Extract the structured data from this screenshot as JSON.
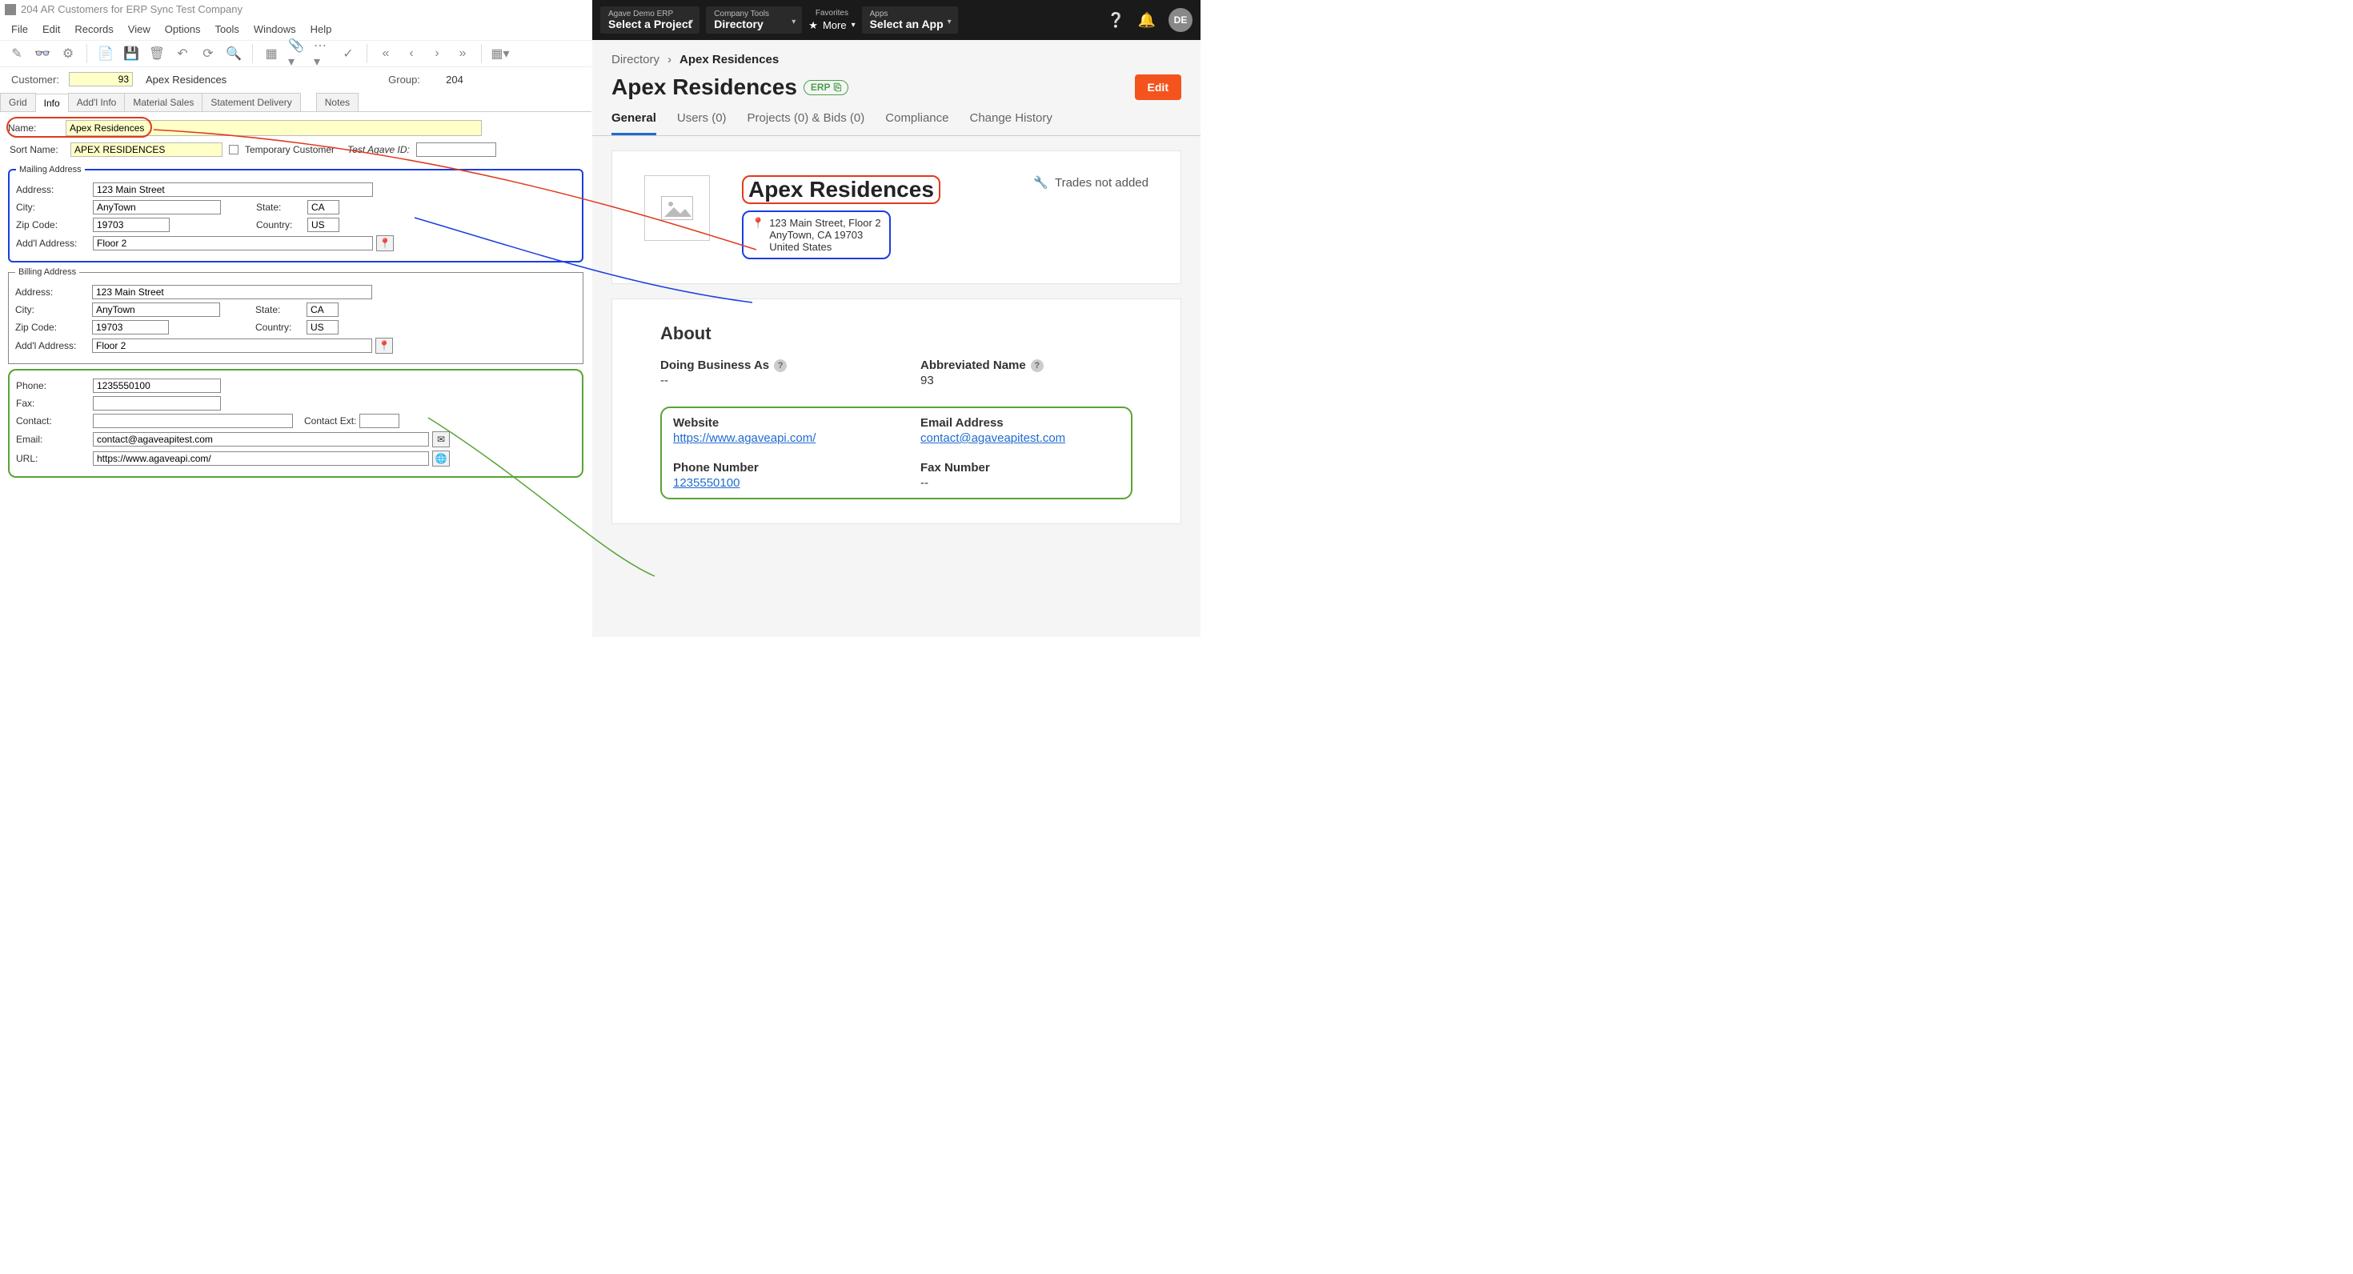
{
  "erp": {
    "window_title": "204 AR Customers for ERP Sync Test Company",
    "menus": [
      "File",
      "Edit",
      "Records",
      "View",
      "Options",
      "Tools",
      "Windows",
      "Help"
    ],
    "customer_label": "Customer:",
    "customer_number": "93",
    "customer_name": "Apex Residences",
    "group_label": "Group:",
    "group_value": "204",
    "tabs": [
      "Grid",
      "Info",
      "Add'l Info",
      "Material Sales",
      "Statement Delivery",
      "Notes"
    ],
    "active_tab": "Info",
    "name_label": "Name:",
    "name_value": "Apex Residences",
    "sort_label": "Sort Name:",
    "sort_value": "APEX RESIDENCES",
    "temp_customer_label": "Temporary Customer",
    "test_agave_label": "Test Agave ID:",
    "mailing": {
      "legend": "Mailing Address",
      "address_label": "Address:",
      "address": "123 Main Street",
      "city_label": "City:",
      "city": "AnyTown",
      "state_label": "State:",
      "state": "CA",
      "zip_label": "Zip Code:",
      "zip": "19703",
      "country_label": "Country:",
      "country": "US",
      "addl_label": "Add'l Address:",
      "addl": "Floor 2"
    },
    "billing": {
      "legend": "Billing Address",
      "address_label": "Address:",
      "address": "123 Main Street",
      "city_label": "City:",
      "city": "AnyTown",
      "state_label": "State:",
      "state": "CA",
      "zip_label": "Zip Code:",
      "zip": "19703",
      "country_label": "Country:",
      "country": "US",
      "addl_label": "Add'l Address:",
      "addl": "Floor 2"
    },
    "contact": {
      "phone_label": "Phone:",
      "phone": "1235550100",
      "fax_label": "Fax:",
      "fax": "",
      "contact_label": "Contact:",
      "contact": "",
      "contact_ext_label": "Contact Ext:",
      "contact_ext": "",
      "email_label": "Email:",
      "email": "contact@agaveapitest.com",
      "url_label": "URL:",
      "url": "https://www.agaveapi.com/"
    }
  },
  "web": {
    "topbar": {
      "erp_small": "Agave Demo ERP",
      "erp_big": "Select a Project",
      "tools_small": "Company Tools",
      "tools_big": "Directory",
      "fav_small": "Favorites",
      "fav_more": "More",
      "apps_small": "Apps",
      "apps_big": "Select an App",
      "avatar": "DE"
    },
    "breadcrumb": {
      "root": "Directory",
      "current": "Apex Residences"
    },
    "title": "Apex Residences",
    "badge": "ERP",
    "edit": "Edit",
    "tabs": [
      "General",
      "Users (0)",
      "Projects (0) & Bids (0)",
      "Compliance",
      "Change History"
    ],
    "card": {
      "name": "Apex Residences",
      "addr1": "123 Main Street, Floor 2",
      "addr2": "AnyTown, CA 19703",
      "addr3": "United States",
      "trades": "Trades not added"
    },
    "about": {
      "heading": "About",
      "dba_label": "Doing Business As",
      "dba_value": "--",
      "abbr_label": "Abbreviated Name",
      "abbr_value": "93",
      "website_label": "Website",
      "website_value": "https://www.agaveapi.com/",
      "email_label": "Email Address",
      "email_value": "contact@agaveapitest.com",
      "phone_label": "Phone Number",
      "phone_value": "1235550100",
      "fax_label": "Fax Number",
      "fax_value": "--"
    }
  }
}
